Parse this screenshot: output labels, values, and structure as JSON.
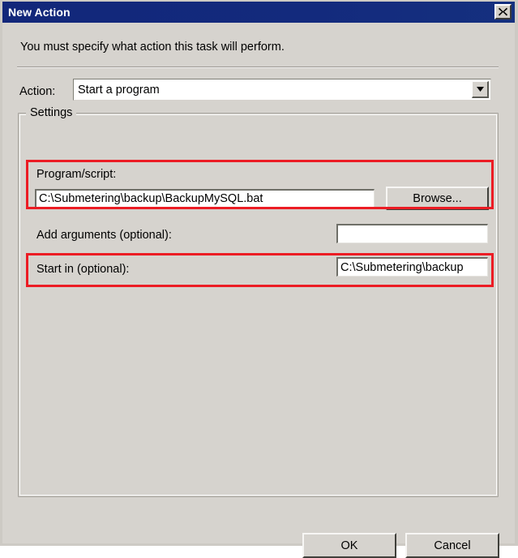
{
  "window": {
    "title": "New Action",
    "close_icon": "close-icon"
  },
  "description": "You must specify what action this task will perform.",
  "action_row": {
    "label": "Action:",
    "value": "Start a program",
    "dropdown_icon": "chevron-down-icon"
  },
  "settings": {
    "legend": "Settings",
    "program": {
      "label": "Program/script:",
      "value": "C:\\Submetering\\backup\\BackupMySQL.bat",
      "browse_label": "Browse..."
    },
    "arguments": {
      "label": "Add arguments (optional):",
      "value": ""
    },
    "start_in": {
      "label": "Start in (optional):",
      "value": "C:\\Submetering\\backup"
    }
  },
  "footer": {
    "ok_label": "OK",
    "cancel_label": "Cancel"
  },
  "annotations": {
    "color": "#ec1c24",
    "highlighted_fields": [
      "program-script",
      "start-in"
    ]
  }
}
